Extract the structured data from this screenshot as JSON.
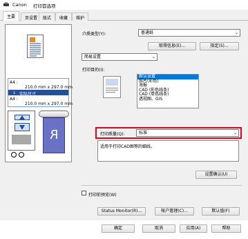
{
  "window": {
    "brand": "Canon",
    "title": "打印首选项"
  },
  "tabs": [
    "主要",
    "页设置",
    "版式",
    "收藏",
    "维护"
  ],
  "preview": {
    "paper_line1": "A4 :",
    "paper_line2": "210.0 mm x 297.0 mm",
    "scaling_label": "实际尺寸",
    "paper_line3": "A4 :",
    "paper_line4": "210.0 mm x 297.0 mm",
    "reverse_glyph": "R"
  },
  "media": {
    "label": "介质类型(Y):",
    "value": "普通纸",
    "get_info_button": "取得信息(E)...",
    "specify_button": "指定(S)..."
  },
  "settings_mode": {
    "value": "简易设置"
  },
  "print_target": {
    "label": "打印目的(I):",
    "items": [
      "默认设置",
      "照片(彩色)",
      "海报",
      "CAD (彩色线条)",
      "CAD (单色线条)",
      "透视图、GIS"
    ],
    "selected_index": 0
  },
  "print_quality": {
    "label": "打印质量(Q):",
    "value": "标准"
  },
  "description": "适用于打印CAD图等的细线。",
  "confirm_settings_button": "设置确认(U)",
  "preview_before_print": {
    "label": "打印前预览(W)",
    "checked": false
  },
  "footer_buttons": {
    "status_monitor": "Status Monitor(R)...",
    "account_management": "帐户管理(C)...",
    "defaults": "默认值(F)"
  },
  "dialog_buttons": {
    "ok": "确定",
    "cancel": "取消",
    "apply": "应用(A)",
    "help": "帮助"
  },
  "colors": {
    "highlight_red": "#e0001b",
    "selection_blue": "#0078d7",
    "page_blue": "#244f99"
  }
}
